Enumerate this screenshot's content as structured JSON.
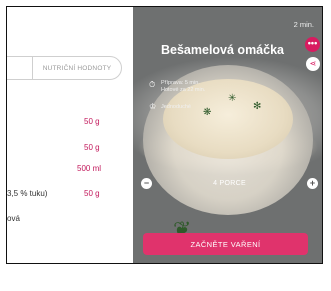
{
  "tabs": {
    "nutrition_label": "NUTRIČNÍ HODNOTY"
  },
  "ingredients": [
    {
      "name": "",
      "amount": "50 g"
    },
    {
      "name": "",
      "amount": "50 g"
    },
    {
      "name": "",
      "amount": "500 ml"
    },
    {
      "name": "3,5 % tuku)",
      "amount": "50 g"
    },
    {
      "name": "ová",
      "amount": ""
    }
  ],
  "recipe": {
    "time_short": "2 min.",
    "title": "Bešamelová omáčka",
    "prep_line1": "Příprava: 5 min.",
    "prep_line2": "Hotové za 22 min.",
    "difficulty": "Jednoduché",
    "portions": "4 PORCE",
    "cta_label": "ZAČNĚTE VAŘENÍ"
  },
  "icons": {
    "more": "more-dots-icon",
    "share": "share-icon",
    "timer": "timer-icon",
    "difficulty": "chef-hat-icon",
    "minus": "minus-icon",
    "plus": "plus-icon"
  },
  "colors": {
    "accent": "#d81b60",
    "cta": "#e0336c",
    "amount": "#c2185b"
  }
}
